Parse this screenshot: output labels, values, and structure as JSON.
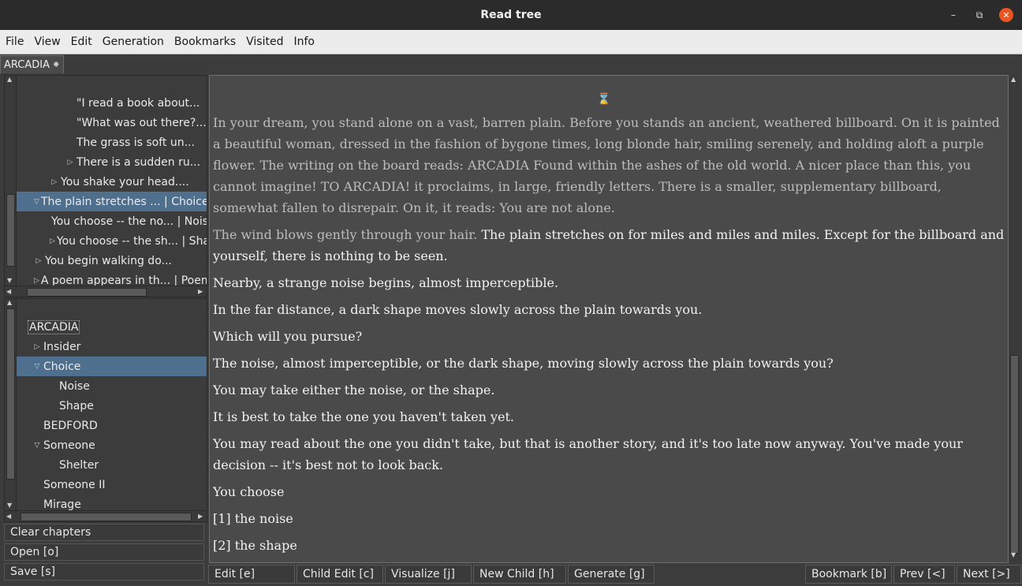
{
  "window": {
    "title": "Read tree"
  },
  "menu": [
    "File",
    "View",
    "Edit",
    "Generation",
    "Bookmarks",
    "Visited",
    "Info"
  ],
  "tab": {
    "label": "ARCADIA"
  },
  "upper_tree": [
    {
      "label": "\"I read a book about...",
      "indent": 3,
      "twisty": ""
    },
    {
      "label": "\"What was out there?...",
      "indent": 3,
      "twisty": ""
    },
    {
      "label": "The grass is soft un...",
      "indent": 3,
      "twisty": ""
    },
    {
      "label": "There is a sudden ru...",
      "indent": 3,
      "twisty": "collapsed"
    },
    {
      "label": "You shake your head....",
      "indent": 2,
      "twisty": "collapsed"
    },
    {
      "label": "The plain stretches ... | Choice",
      "indent": 1,
      "twisty": "expanded",
      "selected": true
    },
    {
      "label": "You choose -- the no... | Noise",
      "indent": 2,
      "twisty": ""
    },
    {
      "label": "You choose -- the sh... | Shape",
      "indent": 2,
      "twisty": "collapsed"
    },
    {
      "label": "You begin walking do...",
      "indent": 1,
      "twisty": "collapsed"
    },
    {
      "label": "A poem appears in th... | Poem",
      "indent": 1,
      "twisty": "collapsed"
    }
  ],
  "chapter_tree": [
    {
      "label": "ARCADIA",
      "indent": 0,
      "twisty": "",
      "focused": true
    },
    {
      "label": "Insider",
      "indent": 1,
      "twisty": "collapsed"
    },
    {
      "label": "Choice",
      "indent": 1,
      "twisty": "expanded",
      "selected": true
    },
    {
      "label": "Noise",
      "indent": 2,
      "twisty": ""
    },
    {
      "label": "Shape",
      "indent": 2,
      "twisty": ""
    },
    {
      "label": "BEDFORD",
      "indent": 1,
      "twisty": ""
    },
    {
      "label": "Someone",
      "indent": 1,
      "twisty": "expanded"
    },
    {
      "label": "Shelter",
      "indent": 2,
      "twisty": ""
    },
    {
      "label": "Someone II",
      "indent": 1,
      "twisty": ""
    },
    {
      "label": "Mirage",
      "indent": 1,
      "twisty": ""
    }
  ],
  "left_buttons": {
    "clear": "Clear chapters",
    "open": "Open [o]",
    "save": "Save [s]"
  },
  "story": {
    "p1": "In your dream, you stand alone on a vast, barren plain. Before you stands an ancient, weathered billboard. On it is painted a beautiful woman, dressed in the fashion of bygone times, long blonde hair, smiling serenely, and holding aloft a purple flower. The writing on the board reads: ARCADIA Found within the ashes of the old world. A nicer place than this, you cannot imagine! TO ARCADIA! it proclaims, in large, friendly letters. There is a smaller, supplementary billboard, somewhat fallen to disrepair. On it, it reads: You are not alone.",
    "p2_dim": "The wind blows gently through your hair.",
    "p2": " The plain stretches on for miles and miles and miles. Except for the billboard and yourself, there is nothing to be seen.",
    "p3": "Nearby, a strange noise begins, almost imperceptible.",
    "p4": "In the far distance, a dark shape moves slowly across the plain towards you.",
    "p5": "Which will you pursue?",
    "p6": "The noise, almost imperceptible, or the dark shape, moving slowly across the plain towards you?",
    "p7": "You may take either the noise, or the shape.",
    "p8": "It is best to take the one you haven't taken yet.",
    "p9": "You may read about the one you didn't take, but that is another story, and it's too late now anyway. You've made your decision -- it's best not to look back.",
    "p10": "You choose",
    "p11": "[1] the noise",
    "p12": "[2] the shape"
  },
  "bottom_buttons": {
    "edit": "Edit [e]",
    "child_edit": "Child Edit [c]",
    "visualize": "Visualize [j]",
    "new_child": "New Child [h]",
    "generate": "Generate [g]",
    "bookmark": "Bookmark [b]",
    "prev": "Prev [<]",
    "next": "Next [>]"
  }
}
